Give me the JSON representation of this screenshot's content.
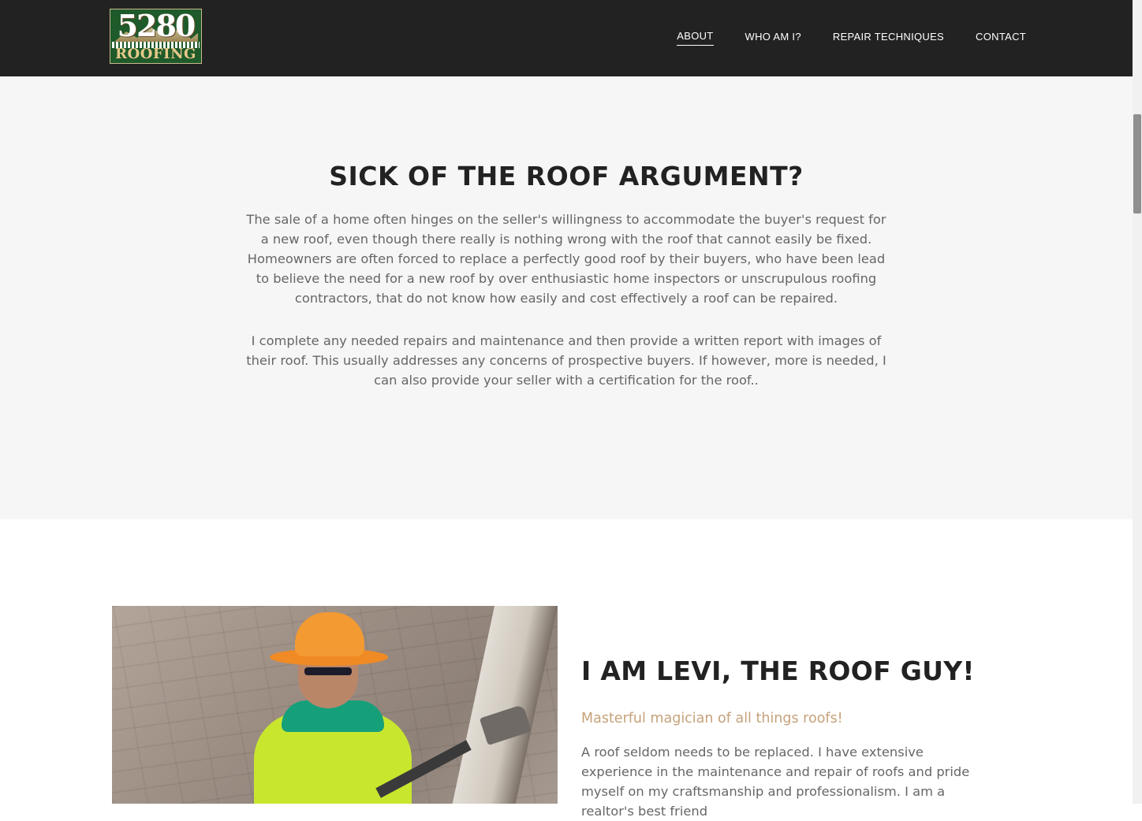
{
  "header": {
    "logo": {
      "number": "5280",
      "word": "ROOFING"
    },
    "nav": [
      {
        "label": "ABOUT",
        "active": true
      },
      {
        "label": "WHO AM I?",
        "active": false
      },
      {
        "label": "REPAIR TECHNIQUES",
        "active": false
      },
      {
        "label": "CONTACT",
        "active": false
      }
    ]
  },
  "section_argument": {
    "title": "SICK OF THE ROOF ARGUMENT?",
    "paragraph_1": "The sale of a home often hinges on the seller's willingness to accommodate the buyer's request for a new roof, even though there really is nothing wrong with the roof that cannot easily be fixed. Homeowners are often forced to replace a perfectly good roof by their buyers, who have been lead to believe the need for a new roof by over enthusiastic home inspectors or unscrupulous roofing contractors, that do not know how easily and cost effectively a roof can be repaired.",
    "paragraph_2": "I complete any needed repairs and maintenance and then provide a written report with images of their roof. This usually addresses any concerns of prospective buyers. If however, more is needed, I can also provide your seller with a certification for the roof.."
  },
  "section_about": {
    "title": "I AM LEVI, THE ROOF GUY!",
    "subtitle": "Masterful magician of all things roofs!",
    "text": "A roof seldom needs to be replaced. I have extensive experience in the maintenance and repair of roofs and pride myself on my craftsmanship and professionalism. I am a realtor's best friend"
  },
  "colors": {
    "header_bg": "#222222",
    "section_gray": "#f6f6f6",
    "accent_subtitle": "#c6a27a",
    "heading": "#222222",
    "body_text": "#666666"
  }
}
